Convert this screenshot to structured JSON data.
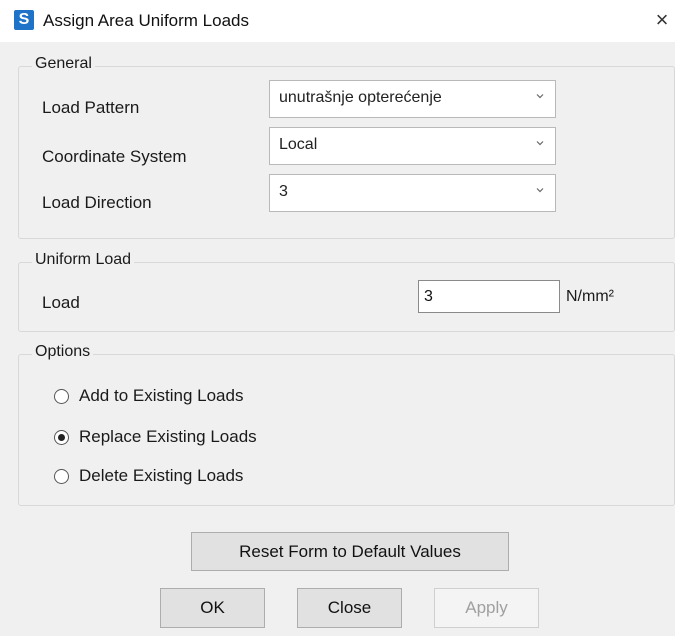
{
  "window": {
    "title": "Assign Area Uniform Loads",
    "icon_letter": "S",
    "close_glyph": "×"
  },
  "general": {
    "group_label": "General",
    "load_pattern": {
      "label": "Load Pattern",
      "value": "unutrašnje opterećenje"
    },
    "coordinate_system": {
      "label": "Coordinate System",
      "value": "Local"
    },
    "load_direction": {
      "label": "Load Direction",
      "value": "3"
    }
  },
  "uniform_load": {
    "group_label": "Uniform Load",
    "load_label": "Load",
    "load_value": "3",
    "unit": "N/mm²"
  },
  "options": {
    "group_label": "Options",
    "items": [
      {
        "label": "Add to Existing Loads",
        "checked": false
      },
      {
        "label": "Replace Existing Loads",
        "checked": true
      },
      {
        "label": "Delete Existing Loads",
        "checked": false
      }
    ]
  },
  "buttons": {
    "reset": "Reset Form to Default Values",
    "ok": "OK",
    "close": "Close",
    "apply": "Apply"
  },
  "colors": {
    "accent": "#1e73c8",
    "dialog_bg": "#f0f0f0"
  }
}
